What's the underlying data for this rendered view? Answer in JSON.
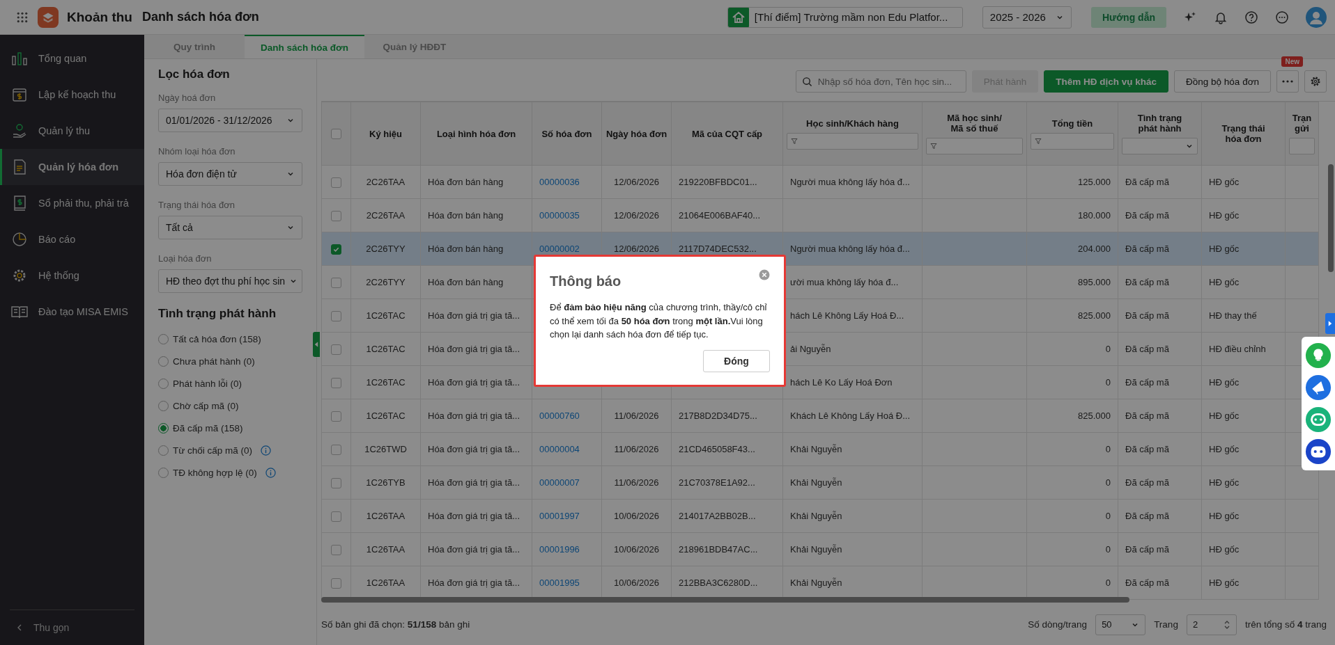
{
  "app": {
    "name": "Khoản thu",
    "page_title": "Danh sách hóa đơn"
  },
  "topbar": {
    "school": "[Thí điểm] Trường mầm non Edu Platfor...",
    "year": "2025 - 2026",
    "guide_button": "Hướng dẫn"
  },
  "sidebar": {
    "items": [
      {
        "label": "Tổng quan",
        "selected": false
      },
      {
        "label": "Lập kế hoạch thu",
        "selected": false
      },
      {
        "label": "Quản lý thu",
        "selected": false
      },
      {
        "label": "Quản lý hóa đơn",
        "selected": true
      },
      {
        "label": "Sổ phải thu, phải trả",
        "selected": false
      },
      {
        "label": "Báo cáo",
        "selected": false
      },
      {
        "label": "Hệ thống",
        "selected": false
      },
      {
        "label": "Đào tạo MISA EMIS",
        "selected": false
      }
    ],
    "collapse": "Thu gọn"
  },
  "tabs": [
    {
      "label": "Quy trình",
      "selected": false
    },
    {
      "label": "Danh sách hóa đơn",
      "selected": true
    },
    {
      "label": "Quản lý HĐĐT",
      "selected": false
    }
  ],
  "filter": {
    "title": "Lọc hóa đơn",
    "fields": [
      {
        "label": "Ngày hoá đơn",
        "value": "01/01/2026 - 31/12/2026"
      },
      {
        "label": "Nhóm loại hóa đơn",
        "value": "Hóa đơn điện tử"
      },
      {
        "label": "Trạng thái hóa đơn",
        "value": "Tất cả"
      },
      {
        "label": "Loại hóa đơn",
        "value": "HĐ theo đợt thu phí học sin"
      }
    ],
    "status_title": "Tình trạng phát hành",
    "statuses": [
      {
        "label": "Tất cả hóa đơn (158)",
        "selected": false,
        "info": false
      },
      {
        "label": "Chưa phát hành (0)",
        "selected": false,
        "info": false
      },
      {
        "label": "Phát hành lỗi (0)",
        "selected": false,
        "info": false
      },
      {
        "label": "Chờ cấp mã (0)",
        "selected": false,
        "info": false
      },
      {
        "label": "Đã cấp mã (158)",
        "selected": true,
        "info": false
      },
      {
        "label": "Từ chối cấp mã (0)",
        "selected": false,
        "info": true
      },
      {
        "label": "TĐ không hợp lệ (0)",
        "selected": false,
        "info": true
      }
    ]
  },
  "toolbar": {
    "search": {
      "placeholder": "Nhập số hóa đơn, Tên học sin..."
    },
    "buttons": [
      {
        "label": "Phát hành",
        "kind": "disabled"
      },
      {
        "label": "Thêm HĐ dịch vụ khác",
        "kind": "primary"
      },
      {
        "label": "Đồng bộ hóa đơn",
        "kind": "default"
      }
    ],
    "more_badge": "New"
  },
  "table": {
    "select_all": {
      "checked": false
    },
    "columns": [
      {
        "label": "Ký hiệu",
        "kind": "plain"
      },
      {
        "label": "Loại hình hóa đơn",
        "kind": "plain"
      },
      {
        "label": "Số hóa đơn",
        "kind": "plain"
      },
      {
        "label": "Ngày hóa đơn",
        "kind": "plain"
      },
      {
        "label": "Mã của CQT cấp",
        "kind": "plain"
      },
      {
        "label": "Học sinh/Khách hàng",
        "kind": "textfilter"
      },
      {
        "label": "Mã học sinh/\nMã số thuế",
        "kind": "textfilter"
      },
      {
        "label": "Tổng tiền",
        "kind": "textfilter"
      },
      {
        "label": "Tình trạng\nphát hành",
        "kind": "selectfilter"
      },
      {
        "label": "Trạng thái\nhóa đơn",
        "kind": "plain"
      },
      {
        "label": "Trạn\ngửi",
        "kind": "boxfilter"
      }
    ],
    "rows": [
      {
        "selected": false,
        "symbol": "2C26TAA",
        "type": "Hóa đơn bán hàng",
        "number": "00000036",
        "date": "12/06/2026",
        "authority_code": "219220BFBDC01...",
        "customer": "Người mua không lấy hóa đ...",
        "total": "125.000",
        "issue_status": "Đã cấp mã",
        "invoice_status": "HĐ gốc"
      },
      {
        "selected": false,
        "symbol": "2C26TAA",
        "type": "Hóa đơn bán hàng",
        "number": "00000035",
        "date": "12/06/2026",
        "authority_code": "21064E006BAF40...",
        "total": "180.000",
        "issue_status": "Đã cấp mã",
        "invoice_status": "HĐ gốc"
      },
      {
        "selected": true,
        "symbol": "2C26TYY",
        "type": "Hóa đơn bán hàng",
        "number": "00000002",
        "date": "12/06/2026",
        "authority_code": "2117D74DEC532...",
        "customer": "Người mua không lấy hóa đ...",
        "total": "204.000",
        "issue_status": "Đã cấp mã",
        "invoice_status": "HĐ gốc"
      },
      {
        "selected": false,
        "symbol": "2C26TYY",
        "type": "Hóa đơn bán hàng",
        "customer": "ười mua không lấy hóa đ...",
        "total": "895.000",
        "issue_status": "Đã cấp mã",
        "invoice_status": "HĐ gốc"
      },
      {
        "selected": false,
        "symbol": "1C26TAC",
        "type": "Hóa đơn giá trị gia tă...",
        "customer": "hách Lê Không Lấy Hoá Đ...",
        "total": "825.000",
        "issue_status": "Đã cấp mã",
        "invoice_status": "HĐ thay thế"
      },
      {
        "selected": false,
        "symbol": "1C26TAC",
        "type": "Hóa đơn giá trị gia tă...",
        "customer": "ải Nguyễn",
        "total": "0",
        "issue_status": "Đã cấp mã",
        "invoice_status": "HĐ điều chỉnh"
      },
      {
        "selected": false,
        "symbol": "1C26TAC",
        "type": "Hóa đơn giá trị gia tă...",
        "customer": "hách Lê Ko Lấy Hoá Đơn",
        "total": "0",
        "issue_status": "Đã cấp mã",
        "invoice_status": "HĐ gốc"
      },
      {
        "selected": false,
        "symbol": "1C26TAC",
        "type": "Hóa đơn giá trị gia tă...",
        "number": "00000760",
        "date": "11/06/2026",
        "authority_code": "217B8D2D34D75...",
        "customer": "Khách Lê Không Lấy Hoá Đ...",
        "total": "825.000",
        "issue_status": "Đã cấp mã",
        "invoice_status": "HĐ gốc"
      },
      {
        "selected": false,
        "symbol": "1C26TWD",
        "type": "Hóa đơn giá trị gia tă...",
        "number": "00000004",
        "date": "11/06/2026",
        "authority_code": "21CD465058F43...",
        "customer": "Khải Nguyễn",
        "total": "0",
        "issue_status": "Đã cấp mã",
        "invoice_status": "HĐ gốc"
      },
      {
        "selected": false,
        "symbol": "1C26TYB",
        "type": "Hóa đơn giá trị gia tă...",
        "number": "00000007",
        "date": "11/06/2026",
        "authority_code": "21C70378E1A92...",
        "customer": "Khải Nguyễn",
        "total": "0",
        "issue_status": "Đã cấp mã",
        "invoice_status": "HĐ gốc"
      },
      {
        "selected": false,
        "symbol": "1C26TAA",
        "type": "Hóa đơn giá trị gia tă...",
        "number": "00001997",
        "date": "10/06/2026",
        "authority_code": "214017A2BB02B...",
        "customer": "Khải Nguyễn",
        "total": "0",
        "issue_status": "Đã cấp mã",
        "invoice_status": "HĐ gốc"
      },
      {
        "selected": false,
        "symbol": "1C26TAA",
        "type": "Hóa đơn giá trị gia tă...",
        "number": "00001996",
        "date": "10/06/2026",
        "authority_code": "218961BDB47AC...",
        "customer": "Khải Nguyễn",
        "total": "0",
        "issue_status": "Đã cấp mã",
        "invoice_status": "HĐ gốc"
      },
      {
        "selected": false,
        "symbol": "1C26TAA",
        "type": "Hóa đơn giá trị gia tă...",
        "number": "00001995",
        "date": "10/06/2026",
        "authority_code": "212BBA3C6280D...",
        "customer": "Khải Nguyễn",
        "total": "0",
        "issue_status": "Đã cấp mã",
        "invoice_status": "HĐ gốc"
      }
    ]
  },
  "footer": {
    "selected_count": "Số bản ghi đã chọn: **51/158** bản ghi",
    "rows_per_page_label": "Số dòng/trang",
    "rows_per_page": "50",
    "page_label": "Trang",
    "page": "2",
    "total_pages": "trên tổng số **4** trang"
  },
  "dialog": {
    "title": "Thông báo",
    "message": "Để **đảm bảo hiệu năng** của chương trình, thầy/cô chỉ có thể xem tối đa **50 hóa đơn** trong **một lần.**Vui lòng chọn lại danh sách hóa đơn để tiếp tục.",
    "button": "Đóng"
  }
}
